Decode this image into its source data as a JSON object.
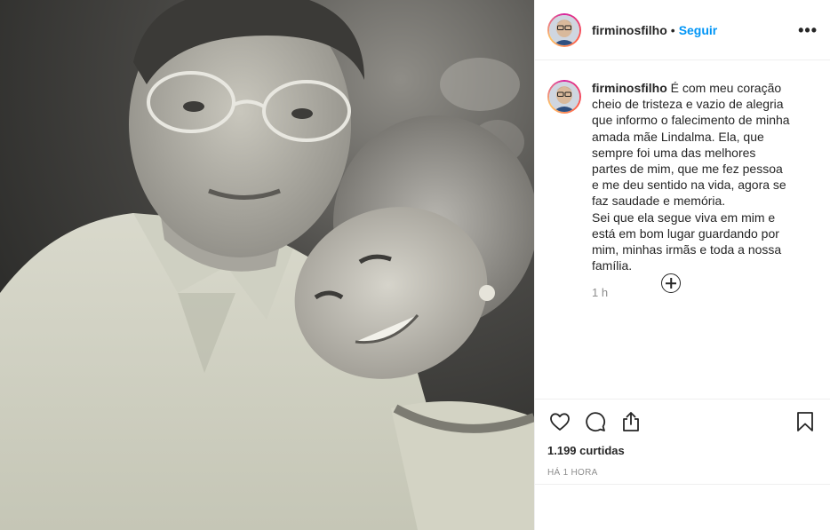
{
  "header": {
    "username": "firminosfilho",
    "separator": "•",
    "follow_label": "Seguir",
    "more_label": "•••"
  },
  "caption": {
    "username": "firminosfilho",
    "text": " É com meu coração cheio de tristeza e vazio de alegria que informo o falecimento de minha amada mãe Lindalma. Ela, que sempre foi uma das melhores partes de mim, que me fez pessoa e me deu sentido na vida, agora se faz saudade e memória.\nSei que ela segue viva em mim e está em bom lugar guardando por mim, minhas irmãs e toda a nossa família.",
    "timestamp": "1 h"
  },
  "actions": {
    "like_icon": "heart-icon",
    "comment_icon": "comment-icon",
    "share_icon": "share-icon",
    "save_icon": "bookmark-icon"
  },
  "likes_label": "1.199 curtidas",
  "posted_time": "HÁ 1 HORA",
  "colors": {
    "accent": "#0095f6",
    "text": "#262626",
    "muted": "#8e8e8e",
    "divider": "#efefef"
  }
}
